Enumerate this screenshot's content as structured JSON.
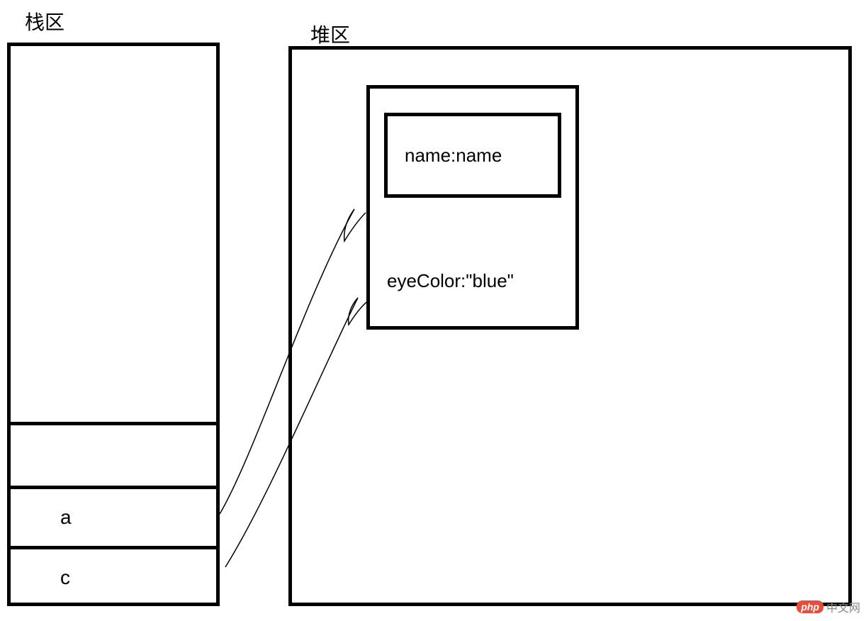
{
  "labels": {
    "stack": "栈区",
    "heap": "堆区"
  },
  "stack": {
    "rows": [
      "",
      "a",
      "c"
    ]
  },
  "heap": {
    "object": {
      "innerProp": "name:name",
      "outerProp": "eyeColor:\"blue\""
    }
  },
  "references": [
    {
      "from": "stack.row[a]",
      "to": "heap.object"
    },
    {
      "from": "stack.row[c]",
      "to": "heap.object"
    }
  ],
  "watermark": {
    "badge": "php",
    "text": "中文网"
  },
  "diagram": {
    "description": "Memory model diagram showing stack area (栈区) with variables 'a' and 'c' both pointing to the same object in the heap area (堆区). The heap object contains a nested box with 'name:name' and a property 'eyeColor:\"blue\"'."
  }
}
